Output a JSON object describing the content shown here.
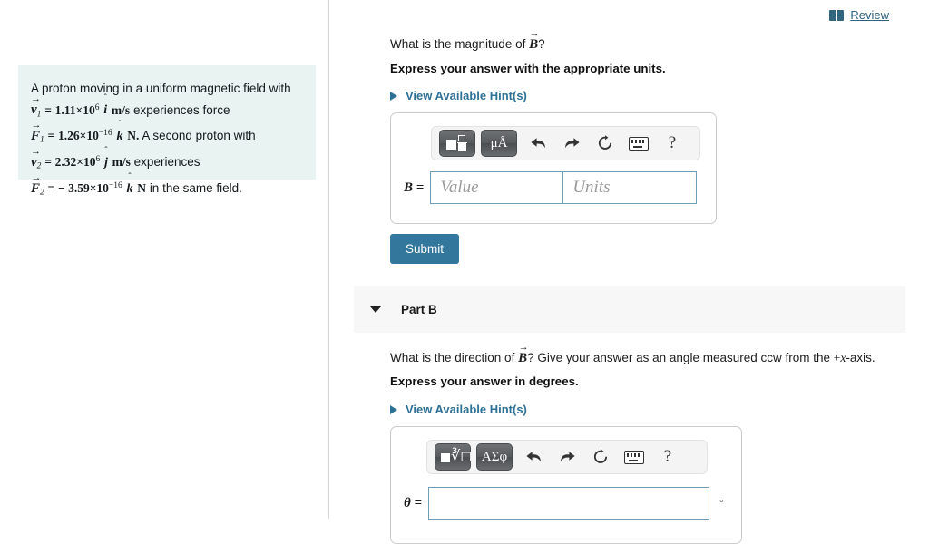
{
  "header": {
    "review_label": "Review",
    "review_icon": "book-icon"
  },
  "problem": {
    "line1": "A proton moving in a uniform magnetic field with",
    "v1_sym": "v",
    "v1_sub": "1",
    "v1_val": "1.11",
    "v1_times": "×10",
    "v1_exp": "6",
    "v1_hatvec": "i",
    "v1_units": "m/s",
    "v1_tail": "experiences force",
    "F1_sym": "F",
    "F1_sub": "1",
    "F1_val": "1.26",
    "F1_times": "×10",
    "F1_exp": "−16",
    "F1_hatvec": "k",
    "F1_units": "N.",
    "F1_tail": "A second proton with",
    "v2_sym": "v",
    "v2_sub": "2",
    "v2_val": "2.32",
    "v2_times": "×10",
    "v2_exp": "6",
    "v2_hatvec": "j",
    "v2_units": "m/s",
    "v2_tail": "experiences",
    "F2_sym": "F",
    "F2_sub": "2",
    "F2_val": "− 3.59",
    "F2_times": "×10",
    "F2_exp": "−16",
    "F2_hatvec": "k",
    "F2_units": "N",
    "F2_tail": "in the same field.",
    "eq": "=",
    "hat": "ˆ",
    "arrow": "→"
  },
  "part_a": {
    "question_pre": "What is the magnitude of ",
    "question_sym": "B",
    "question_post": "?",
    "instruction": "Express your answer with the appropriate units.",
    "hints_label": "View Available Hint(s)",
    "toolbar": {
      "template_icon": "template-grid-icon",
      "units_label": "μÅ",
      "undo_icon": "⬅",
      "redo_icon": "➡",
      "reset_icon": "↻",
      "keyboard_icon": "keyboard-icon",
      "help_label": "?"
    },
    "field_label": "B =",
    "value_placeholder": "Value",
    "units_placeholder": "Units",
    "value": "",
    "units_value": "",
    "submit_label": "Submit"
  },
  "part_b": {
    "title": "Part B",
    "question_pre": "What is the direction of ",
    "question_sym": "B",
    "question_mid": "? Give your answer as an angle measured ccw from the ",
    "question_axis_plus": "+",
    "question_axis_x": "x",
    "question_axis_post": "-axis.",
    "instruction": "Express your answer in degrees.",
    "hints_label": "View Available Hint(s)",
    "toolbar": {
      "template_icon": "template-radical-icon",
      "greek_label": "ΑΣφ",
      "undo_icon": "⬅",
      "redo_icon": "➡",
      "reset_icon": "↻",
      "keyboard_icon": "keyboard-icon",
      "help_label": "?"
    },
    "field_label": "θ =",
    "value": "",
    "degree_symbol": "°"
  },
  "colors": {
    "problem_bg": "#e9f4f2",
    "link": "#2e7196",
    "submit": "#33779c",
    "input_border": "#6f9db5",
    "part_header_bg": "#f7f7f7"
  }
}
